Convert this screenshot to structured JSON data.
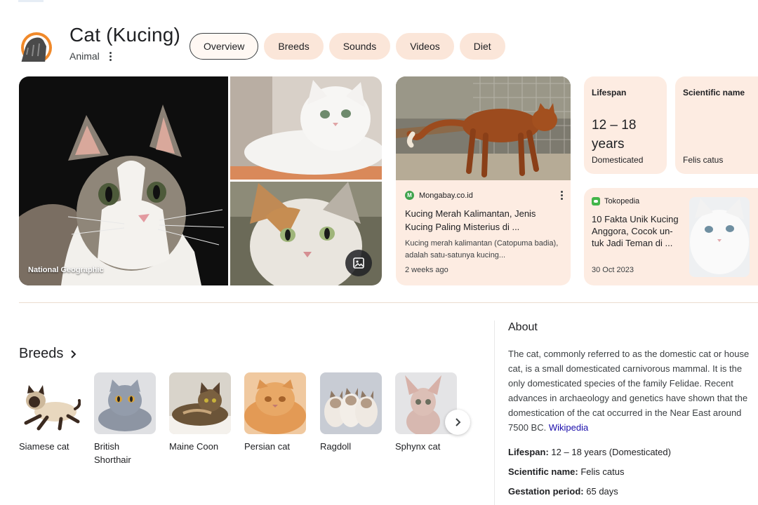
{
  "header": {
    "title": "Cat (Kucing)",
    "subtitle": "Animal"
  },
  "tabs": [
    {
      "label": "Overview",
      "active": true
    },
    {
      "label": "Breeds",
      "active": false
    },
    {
      "label": "Sounds",
      "active": false
    },
    {
      "label": "Videos",
      "active": false
    },
    {
      "label": "Diet",
      "active": false
    }
  ],
  "photos": {
    "credit": "National Geographic"
  },
  "news": [
    {
      "source": "Mongabay.co.id",
      "source_initial": "M",
      "headline": "Kucing Merah Kalimantan, Jenis Kucing Paling Misterius di ...",
      "snippet": "Kucing merah kalimantan (Catopuma badia), adalah satu-satunya kucing...",
      "date": "2 weeks ago"
    },
    {
      "source": "Tokopedia",
      "headline": "10 Fakta Unik Kucing Anggora, Cocok un-tuk Jadi Teman di ...",
      "date": "30 Oct 2023"
    }
  ],
  "facts": {
    "lifespan": {
      "title": "Lifespan",
      "value": "12 – 18 years",
      "note": "Domesticated"
    },
    "scientific": {
      "title": "Scientific name",
      "value": "Felis catus"
    }
  },
  "breeds": {
    "heading": "Breeds",
    "items": [
      "Siamese cat",
      "British Shorthair",
      "Maine Coon",
      "Persian cat",
      "Ragdoll",
      "Sphynx cat"
    ]
  },
  "about": {
    "title": "About",
    "text": "The cat, commonly referred to as the domestic cat or house cat, is a small domesticated carnivorous mammal. It is the only domesticated species of the family Felidae. Recent advances in archaeology and genetics have shown that the domestication of the cat occurred in the Near East around 7500 BC.",
    "link": "Wikipedia",
    "lines": [
      {
        "label": "Lifespan:",
        "value": "12 – 18 years (Domesticated)"
      },
      {
        "label": "Scientific name:",
        "value": "Felis catus"
      },
      {
        "label": "Gestation period:",
        "value": "65 days"
      }
    ]
  },
  "colors": {
    "card_bg": "#fdece2",
    "tab_bg": "#fbe6d9",
    "link": "#1a0dab"
  }
}
